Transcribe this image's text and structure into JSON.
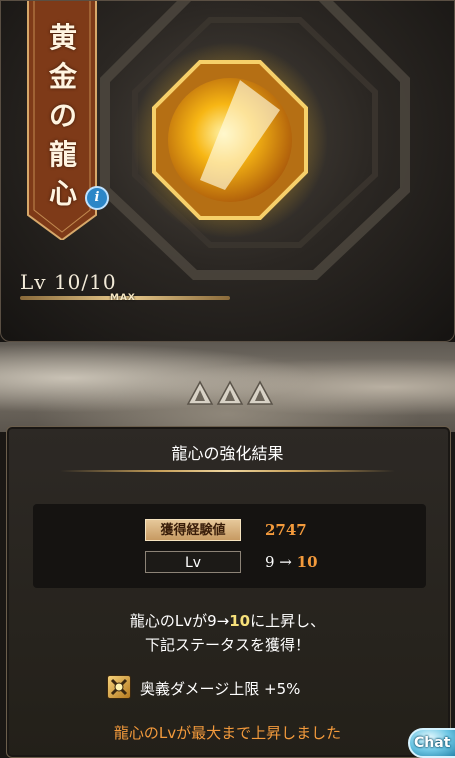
{
  "item": {
    "name": "黄金の龍心",
    "level_label": "Lv 10/10",
    "max_label": "MAX"
  },
  "panel": {
    "title": "龍心の強化結果",
    "exp_label": "獲得経験値",
    "exp_value": "2747",
    "lv_label": "Lv",
    "lv_from": "9 →",
    "lv_to": "10"
  },
  "messages": {
    "line1_prefix": "龍心のLvが9→",
    "line1_highlight": "10",
    "line1_suffix": "に上昇し、",
    "line2": "下記ステータスを獲得！",
    "bonus": "奥義ダメージ上限 +5%",
    "max_reached": "龍心のLvが最大まで上昇しました"
  },
  "chat_button": "Chat",
  "colors": {
    "accent_orange": "#f39a3c",
    "highlight_yellow": "#f6e07a",
    "ribbon": "#8a3f1c",
    "orb_gold": "#f5b81a"
  },
  "icons": {
    "info": "info-icon",
    "bonus": "ougi-damage-icon",
    "progress": "triangle-progress-icon"
  }
}
